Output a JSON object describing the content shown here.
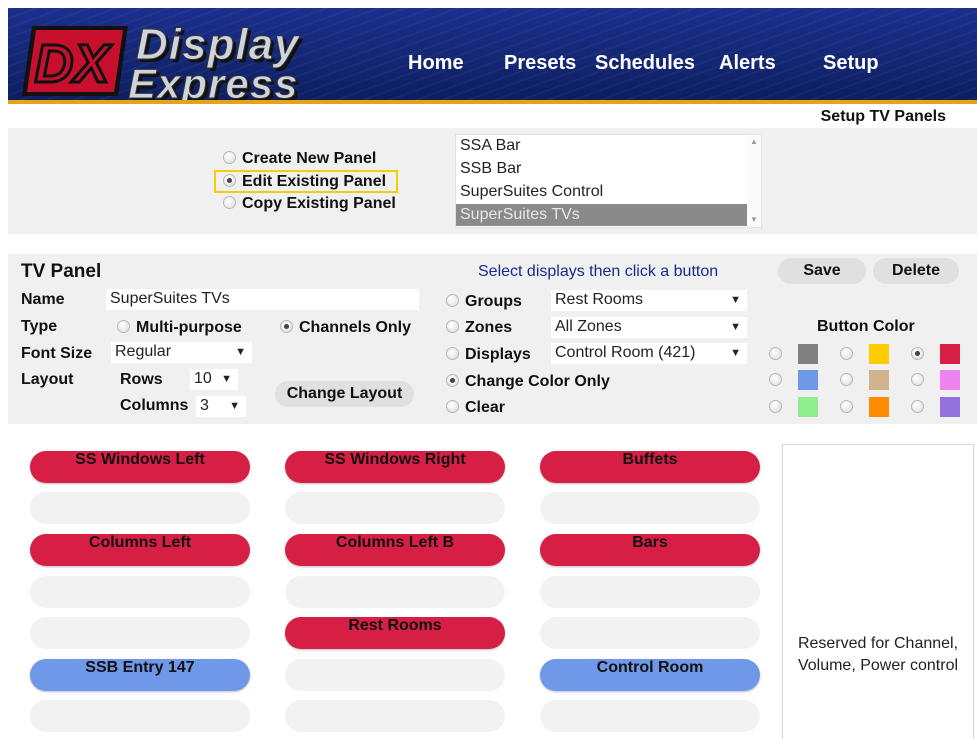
{
  "header": {
    "logo_letters": "DX",
    "logo_word1": "Display",
    "logo_word2": "Express",
    "nav": [
      "Home",
      "Presets",
      "Schedules",
      "Alerts",
      "Setup"
    ]
  },
  "page_title": "Setup TV Panels",
  "panel_mode": {
    "options": [
      "Create New Panel",
      "Edit Existing Panel",
      "Copy Existing Panel"
    ],
    "selected": "Edit Existing Panel"
  },
  "panel_list": {
    "items": [
      "SSA Bar",
      "SSB Bar",
      "SuperSuites Control",
      "SuperSuites TVs"
    ],
    "selected": "SuperSuites TVs"
  },
  "editor": {
    "heading": "TV Panel",
    "hint": "Select displays then click a button",
    "save": "Save",
    "delete": "Delete",
    "name_label": "Name",
    "name_value": "SuperSuites TVs",
    "type_label": "Type",
    "type_options": [
      "Multi-purpose",
      "Channels Only"
    ],
    "type_selected": "Channels Only",
    "font_size_label": "Font Size",
    "font_size_value": "Regular",
    "layout_label": "Layout",
    "rows_label": "Rows",
    "rows_value": "10",
    "columns_label": "Columns",
    "columns_value": "3",
    "change_layout": "Change Layout",
    "groups_label": "Groups",
    "groups_value": "Rest Rooms",
    "zones_label": "Zones",
    "zones_value": "All Zones",
    "displays_label": "Displays",
    "displays_value": "Control Room (421)",
    "change_color_only": "Change Color Only",
    "clear": "Clear",
    "action_selected": "Change Color Only",
    "button_color_label": "Button Color",
    "colors": [
      "#808080",
      "#ffcc00",
      "#d71f45",
      "#6f98e8",
      "#d2b48c",
      "#ee82ee",
      "#90ee90",
      "#ff8c00",
      "#9370db"
    ],
    "selected_color": "#d71f45"
  },
  "grid": {
    "columns": [
      [
        {
          "label": "SS Windows Left",
          "color": "red"
        },
        {
          "label": "",
          "color": "empty"
        },
        {
          "label": "Columns Left",
          "color": "red"
        },
        {
          "label": "",
          "color": "empty"
        },
        {
          "label": "",
          "color": "empty"
        },
        {
          "label": "SSB Entry 147",
          "color": "blue"
        },
        {
          "label": "",
          "color": "empty"
        }
      ],
      [
        {
          "label": "SS Windows Right",
          "color": "red"
        },
        {
          "label": "",
          "color": "empty"
        },
        {
          "label": "Columns Left B",
          "color": "red"
        },
        {
          "label": "",
          "color": "empty"
        },
        {
          "label": "Rest Rooms",
          "color": "red"
        },
        {
          "label": "",
          "color": "empty"
        },
        {
          "label": "",
          "color": "empty"
        }
      ],
      [
        {
          "label": "Buffets",
          "color": "red"
        },
        {
          "label": "",
          "color": "empty"
        },
        {
          "label": "Bars",
          "color": "red"
        },
        {
          "label": "",
          "color": "empty"
        },
        {
          "label": "",
          "color": "empty"
        },
        {
          "label": "Control Room",
          "color": "blue"
        },
        {
          "label": "",
          "color": "empty"
        }
      ]
    ],
    "reserved_text": "Reserved for Channel, Volume, Power control"
  }
}
